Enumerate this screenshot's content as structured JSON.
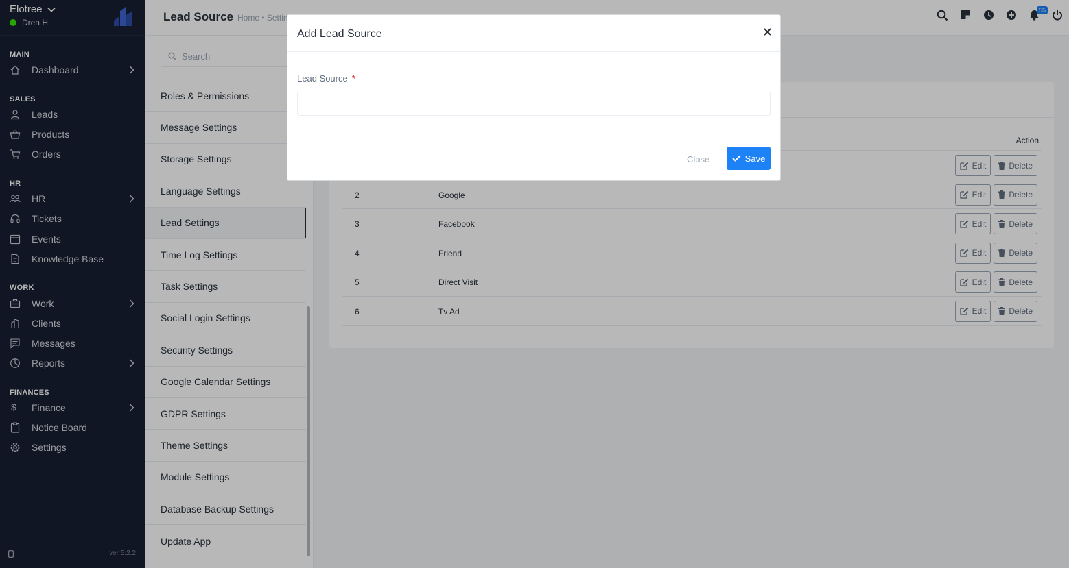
{
  "sidebar": {
    "company": "Elotree",
    "user": "Drea H.",
    "version": "ver 5.2.2",
    "sections": {
      "main": "MAIN",
      "sales": "SALES",
      "hr": "HR",
      "work": "WORK",
      "finances": "FINANCES"
    },
    "items": {
      "dashboard": "Dashboard",
      "leads": "Leads",
      "products": "Products",
      "orders": "Orders",
      "hr": "HR",
      "tickets": "Tickets",
      "events": "Events",
      "knowledge_base": "Knowledge Base",
      "work": "Work",
      "clients": "Clients",
      "messages": "Messages",
      "reports": "Reports",
      "finance": "Finance",
      "notice_board": "Notice Board",
      "settings": "Settings"
    }
  },
  "header": {
    "title": "Lead Source",
    "breadcrumb": "Home • Setting",
    "notification_count": "55"
  },
  "settings_menu": {
    "search_placeholder": "Search",
    "items": [
      "Roles & Permissions",
      "Message Settings",
      "Storage Settings",
      "Language Settings",
      "Lead Settings",
      "Time Log Settings",
      "Task Settings",
      "Social Login Settings",
      "Security Settings",
      "Google Calendar Settings",
      "GDPR Settings",
      "Theme Settings",
      "Module Settings",
      "Database Backup Settings",
      "Update App"
    ],
    "active": "Lead Settings"
  },
  "table": {
    "action_header": "Action",
    "edit_label": "Edit",
    "delete_label": "Delete",
    "rows": [
      {
        "num": "",
        "name": ""
      },
      {
        "num": "2",
        "name": "Google"
      },
      {
        "num": "3",
        "name": "Facebook"
      },
      {
        "num": "4",
        "name": "Friend"
      },
      {
        "num": "5",
        "name": "Direct Visit"
      },
      {
        "num": "6",
        "name": "Tv Ad"
      }
    ]
  },
  "modal": {
    "title": "Add Lead Source",
    "field_label": "Lead Source",
    "required_mark": "*",
    "field_value": "",
    "close_label": "Close",
    "save_label": "Save"
  },
  "colors": {
    "sidebar_bg": "#171f31",
    "primary": "#1d82f5",
    "online": "#39e500"
  }
}
